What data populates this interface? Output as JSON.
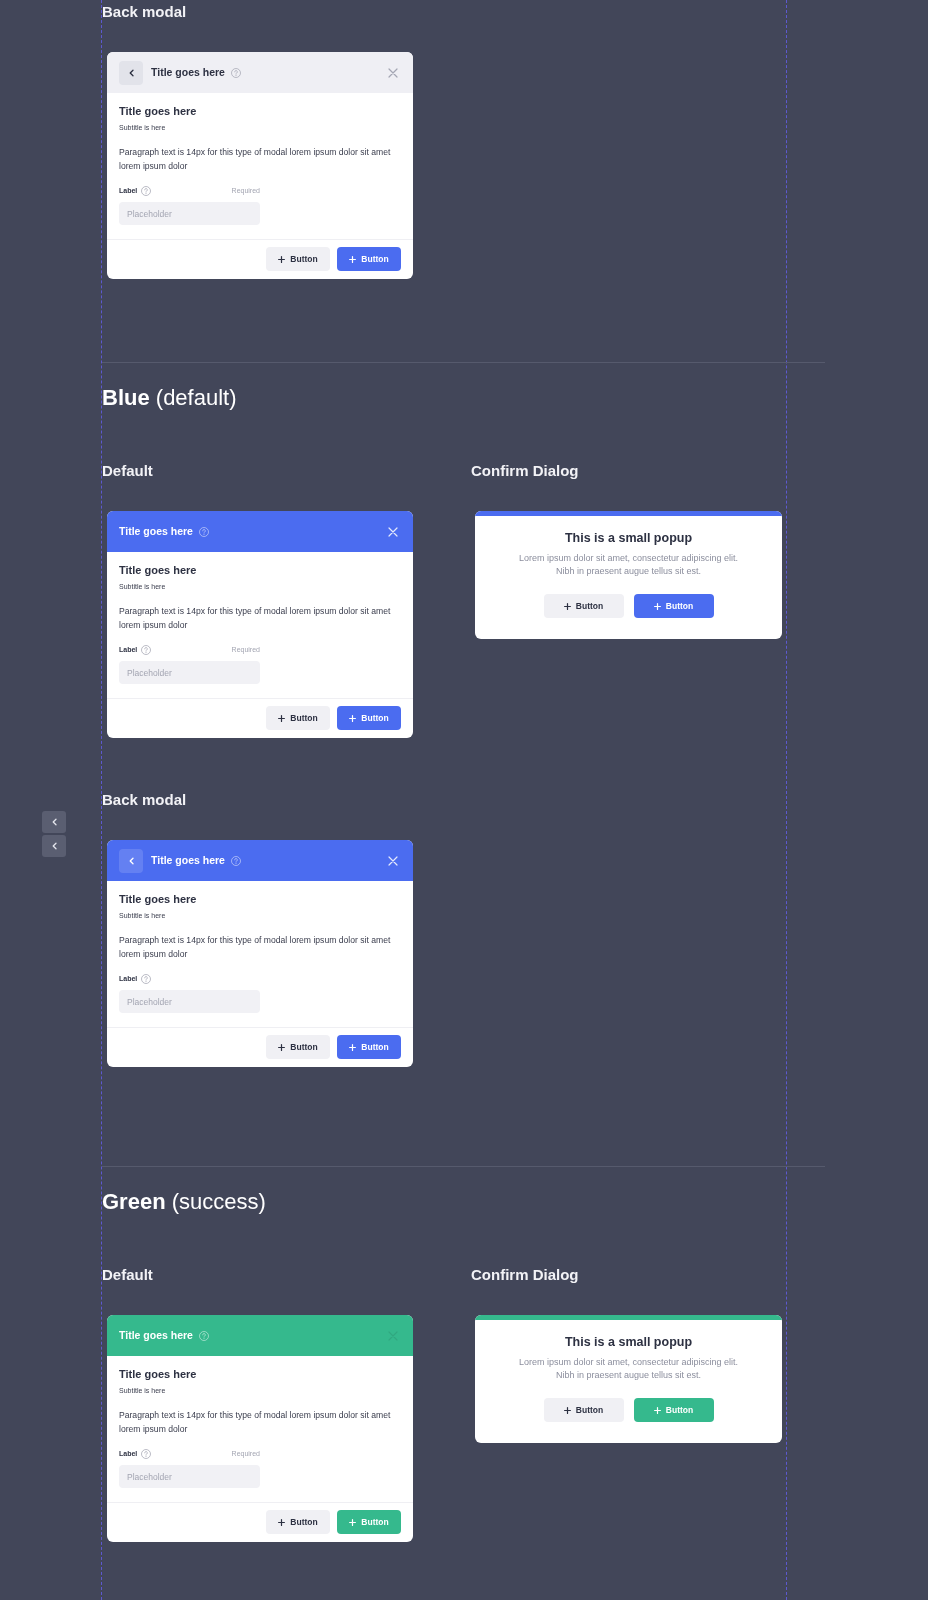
{
  "sections": [
    {
      "panels": [
        {
          "heading": "Back modal",
          "kind": "modal",
          "header": {
            "title": "Title goes here",
            "color": "#efeff4",
            "back_button": true,
            "close": {
              "disabled": false
            }
          },
          "title": "Title goes here",
          "subtitle": "Subtitle is here",
          "paragraph": "Paragraph text is 14px for this type of modal lorem ipsum dolor sit amet lorem ipsum dolor",
          "field": {
            "label": "Label",
            "required": "Required",
            "placeholder": "Placeholder"
          },
          "buttons": [
            {
              "label": "Button",
              "kind": "secondary"
            },
            {
              "label": "Button",
              "kind": "primary",
              "color": "#4b6cf0"
            }
          ]
        }
      ]
    },
    {
      "title": "**Blue** (default)",
      "panels": [
        {
          "heading": "Default",
          "kind": "modal",
          "header": {
            "title": "Title goes here",
            "color": "#4b6cf0",
            "back_button": false,
            "close": {
              "disabled": false
            }
          },
          "title": "Title goes here",
          "subtitle": "Subtitle is here",
          "paragraph": "Paragraph text is 14px for this type of modal lorem ipsum dolor sit amet lorem ipsum dolor",
          "field": {
            "label": "Label",
            "required": "Required",
            "placeholder": "Placeholder"
          },
          "buttons": [
            {
              "label": "Button",
              "kind": "secondary"
            },
            {
              "label": "Button",
              "kind": "primary",
              "color": "#4b6cf0"
            }
          ]
        },
        {
          "heading": "Confirm Dialog",
          "kind": "confirm",
          "color": "#4b6cf0",
          "title": "This is a small popup",
          "message": [
            "Lorem ipsum dolor sit amet, consectetur adipiscing elit.",
            "Nibh in praesent augue tellus sit est."
          ],
          "buttons": [
            {
              "label": "Button",
              "kind": "secondary"
            },
            {
              "label": "Button",
              "kind": "primary",
              "color": "#4b6cf0"
            }
          ]
        },
        {
          "heading": "Back modal",
          "kind": "modal",
          "side_controls": [
            {
              "kind": "back"
            },
            {
              "kind": "back"
            }
          ],
          "header": {
            "title": "Title goes here",
            "color": "#4b6cf0",
            "back_button": true,
            "close": {
              "disabled": false
            }
          },
          "title": "Title goes here",
          "subtitle": "Subtitle is here",
          "paragraph": "Paragraph text is 14px for this type of modal lorem ipsum dolor sit amet lorem ipsum dolor",
          "field": {
            "label": "Label",
            "placeholder": "Placeholder"
          },
          "buttons": [
            {
              "label": "Button",
              "kind": "secondary"
            },
            {
              "label": "Button",
              "kind": "primary",
              "color": "#4b6cf0"
            }
          ]
        }
      ]
    },
    {
      "title": "**Green** (success)",
      "panels": [
        {
          "heading": "Default",
          "kind": "modal",
          "header": {
            "title": "Title goes here",
            "color": "#35b98d",
            "back_button": false,
            "close": {
              "disabled": true
            }
          },
          "title": "Title goes here",
          "subtitle": "Subtitle is here",
          "paragraph": "Paragraph text is 14px for this type of modal lorem ipsum dolor sit amet lorem ipsum dolor",
          "field": {
            "label": "Label",
            "required": "Required",
            "placeholder": "Placeholder"
          },
          "buttons": [
            {
              "label": "Button",
              "kind": "secondary"
            },
            {
              "label": "Button",
              "kind": "primary",
              "color": "#35b98d"
            }
          ]
        },
        {
          "heading": "Confirm Dialog",
          "kind": "confirm",
          "color": "#35b98d",
          "title": "This is a small popup",
          "message": [
            "Lorem ipsum dolor sit amet, consectetur adipiscing elit.",
            "Nibh in praesent augue tellus sit est."
          ],
          "buttons": [
            {
              "label": "Button",
              "kind": "secondary"
            },
            {
              "label": "Button",
              "kind": "primary",
              "color": "#35b98d"
            }
          ]
        }
      ]
    }
  ]
}
